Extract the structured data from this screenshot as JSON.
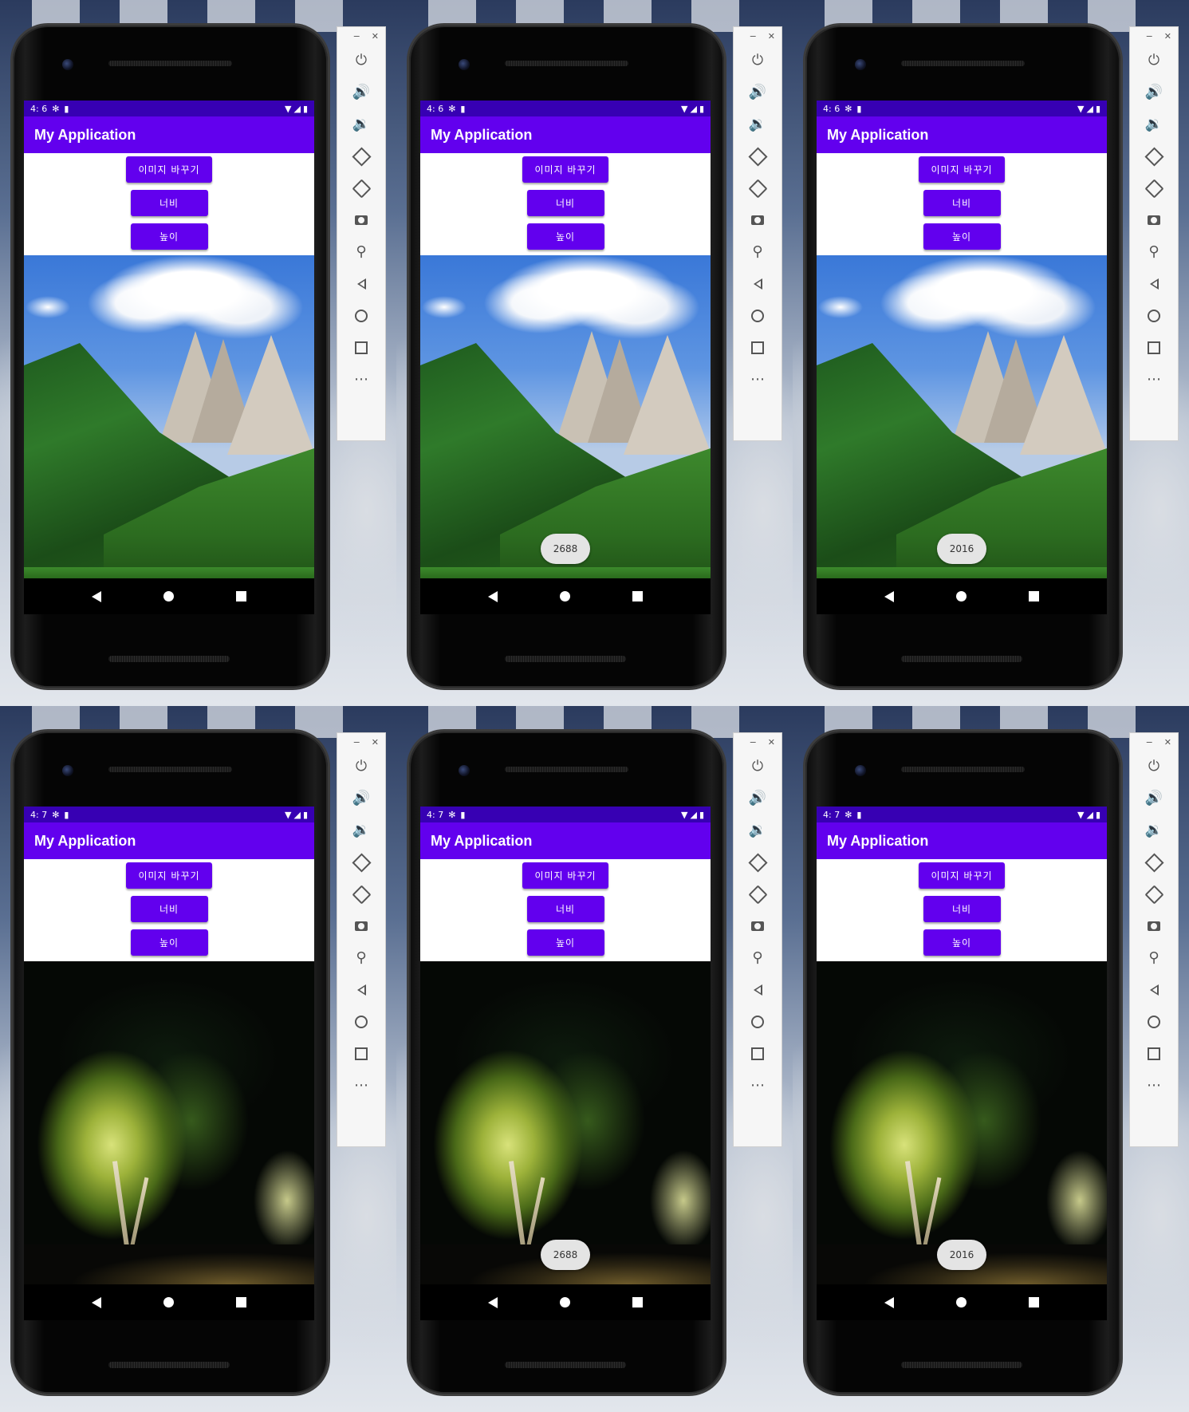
{
  "app": {
    "title": "My Application",
    "accent_color": "#6200ee",
    "status_bar_color": "#3700b3"
  },
  "buttons": {
    "change_image": "이미지 바꾸기",
    "width": "너비",
    "height": "높이"
  },
  "tool_window": {
    "minimize": "−",
    "close": "✕",
    "icons": [
      "power-icon",
      "volume-up-icon",
      "volume-down-icon",
      "rotate-left-icon",
      "rotate-right-icon",
      "screenshot-icon",
      "zoom-icon",
      "back-icon",
      "home-icon",
      "overview-icon",
      "more-icon"
    ]
  },
  "nav_icons": [
    "back-icon",
    "home-icon",
    "recents-icon"
  ],
  "panels": [
    {
      "time": "4: 6",
      "image": "mountain",
      "toast": null
    },
    {
      "time": "4: 6",
      "image": "mountain",
      "toast": "2688"
    },
    {
      "time": "4: 6",
      "image": "mountain",
      "toast": "2016"
    },
    {
      "time": "4: 7",
      "image": "tree",
      "toast": null
    },
    {
      "time": "4: 7",
      "image": "tree",
      "toast": "2688"
    },
    {
      "time": "4: 7",
      "image": "tree",
      "toast": "2016"
    }
  ]
}
